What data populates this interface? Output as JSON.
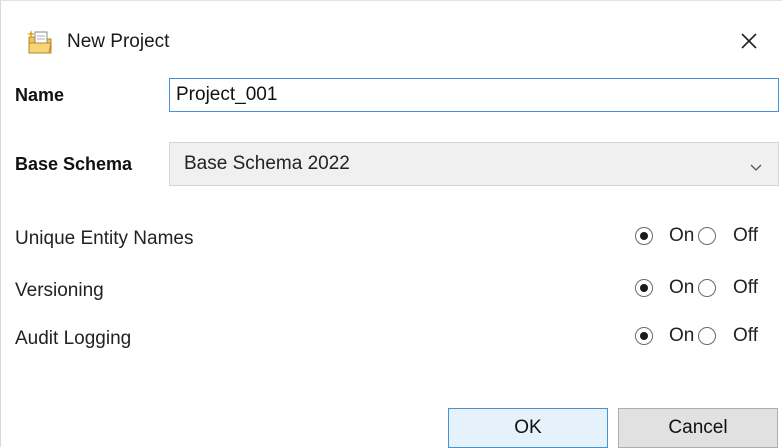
{
  "dialog": {
    "title": "New Project",
    "icon": "new-project-icon",
    "close_icon": "close-icon"
  },
  "form": {
    "name_label": "Name",
    "name_value": "Project_001",
    "base_schema_label": "Base Schema",
    "base_schema_value": "Base Schema 2022"
  },
  "options": [
    {
      "label": "Unique Entity Names",
      "on_label": "On",
      "off_label": "Off",
      "selected": "On"
    },
    {
      "label": "Versioning",
      "on_label": "On",
      "off_label": "Off",
      "selected": "On"
    },
    {
      "label": "Audit Logging",
      "on_label": "On",
      "off_label": "Off",
      "selected": "On"
    }
  ],
  "buttons": {
    "ok_label": "OK",
    "cancel_label": "Cancel"
  }
}
